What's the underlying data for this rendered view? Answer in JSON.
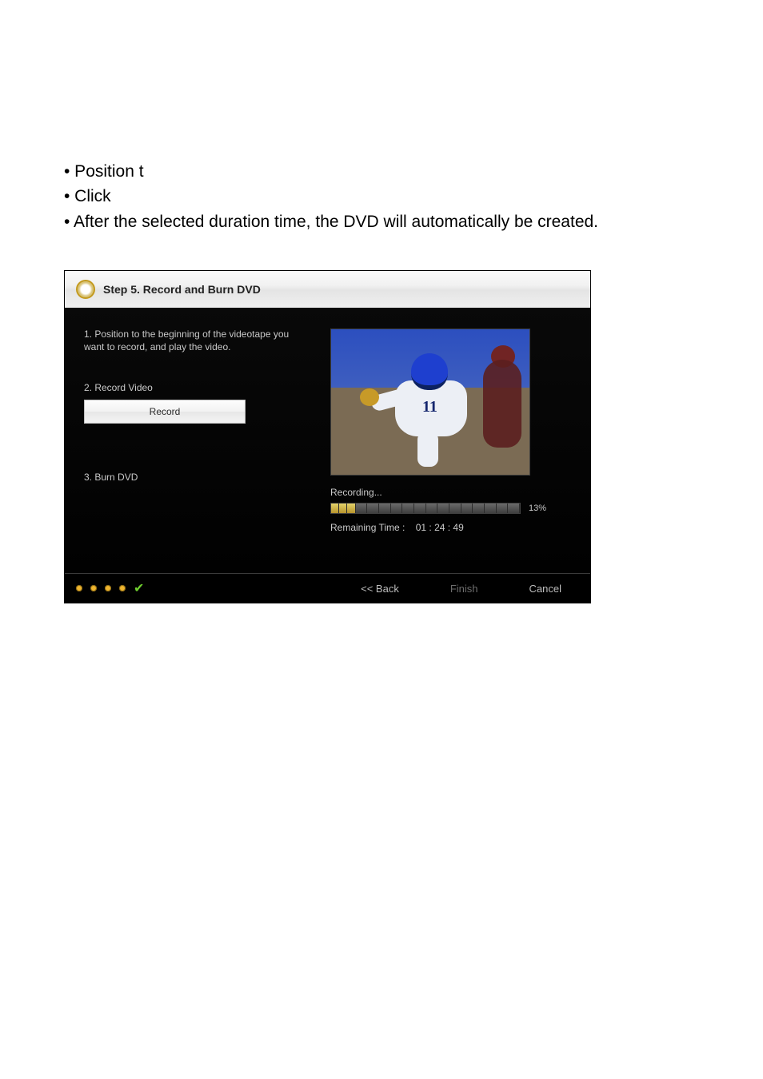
{
  "bullets": {
    "b1": "• Position t",
    "b2": "• Click",
    "b3": "• After the selected duration time, the DVD will automatically be created."
  },
  "header": {
    "title": "Step 5. Record and Burn DVD"
  },
  "left": {
    "step1": "1. Position to the beginning of the videotape you want to record, and play the video.",
    "step2": "2. Record Video",
    "record_btn": "Record",
    "step3": "3. Burn DVD"
  },
  "status": {
    "recording": "Recording...",
    "percent": "13%",
    "remaining_label": "Remaining Time :",
    "remaining_value": "01 : 24 : 49"
  },
  "footer": {
    "back": "<< Back",
    "finish": "Finish",
    "cancel": "Cancel"
  }
}
